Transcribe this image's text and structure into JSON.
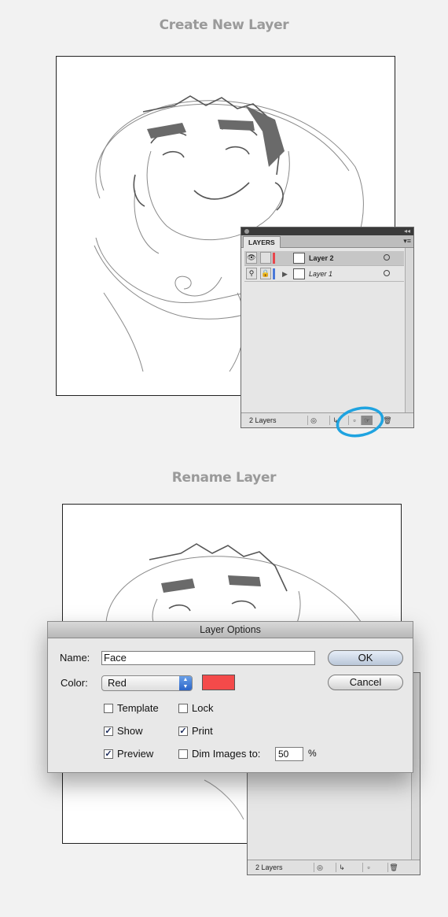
{
  "section1": {
    "heading": "Create New Layer"
  },
  "section2": {
    "heading": "Rename Layer"
  },
  "panel1": {
    "tab": "LAYERS",
    "layers": [
      {
        "name": "Layer 2",
        "color": "#e8464c"
      },
      {
        "name": "Layer 1",
        "color": "#4a78d8"
      }
    ],
    "count_label": "2 Layers",
    "highlight_color": "#1fa3e0"
  },
  "panel2": {
    "count_label": "2 Layers"
  },
  "dialog": {
    "title": "Layer Options",
    "name_label": "Name:",
    "name_value": "Face",
    "color_label": "Color:",
    "color_value": "Red",
    "swatch_color": "#f44a4a",
    "ok_label": "OK",
    "cancel_label": "Cancel",
    "checkboxes": {
      "template": {
        "label": "Template",
        "checked": false
      },
      "lock": {
        "label": "Lock",
        "checked": false
      },
      "show": {
        "label": "Show",
        "checked": true
      },
      "print": {
        "label": "Print",
        "checked": true
      },
      "preview": {
        "label": "Preview",
        "checked": true
      },
      "dim": {
        "label": "Dim Images to:",
        "checked": false
      }
    },
    "dim_value": "50",
    "dim_unit": "%"
  }
}
